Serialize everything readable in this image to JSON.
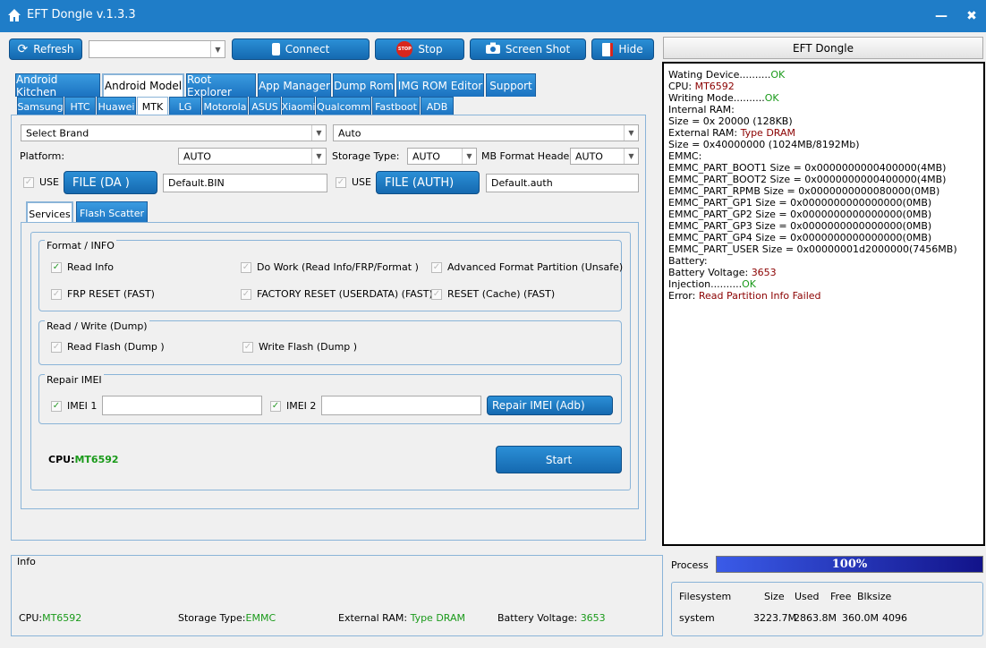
{
  "window": {
    "title": "EFT Dongle  v.1.3.3",
    "minimize": "—",
    "close": "✖"
  },
  "toolbar": {
    "refresh": "Refresh",
    "connect": "Connect",
    "stop": "Stop",
    "screenshot": "Screen Shot",
    "hide": "Hide",
    "port_value": "",
    "stop_icon_text": "STOP"
  },
  "right_header": "EFT Dongle",
  "main_tabs": [
    "Android Kitchen",
    "Android Model",
    "Root Explorer",
    "App Manager",
    "Dump Rom",
    "IMG ROM Editor",
    "Support"
  ],
  "sub_tabs": [
    "Samsung",
    "HTC",
    "Huawei",
    "MTK",
    "LG",
    "Motorola",
    "ASUS",
    "Xiaomi",
    "Qualcomm",
    "Fastboot",
    "ADB"
  ],
  "config": {
    "brand": "Select Brand",
    "auto_combo": "Auto",
    "platform_label": "Platform:",
    "platform": "AUTO",
    "storage_label": "Storage Type:",
    "storage": "AUTO",
    "mbformat_label": "MB Format Header",
    "mbformat": "AUTO",
    "use_label": "USE",
    "file_da": "FILE (DA )",
    "da_file": "Default.BIN",
    "use2_label": "USE",
    "file_auth": "FILE (AUTH)",
    "auth_file": "Default.auth"
  },
  "inner_tabs": [
    "Services",
    "Flash Scatter"
  ],
  "format_group": {
    "title": "Format / INFO",
    "items": [
      "Read Info",
      "Do Work (Read Info/FRP/Format )",
      "Advanced Format Partition (Unsafe)",
      "FRP RESET (FAST)",
      "FACTORY RESET (USERDATA) (FAST)",
      "RESET (Cache) (FAST)"
    ]
  },
  "rw_group": {
    "title": "Read / Write (Dump)",
    "items": [
      "Read Flash (Dump )",
      "Write Flash (Dump )"
    ]
  },
  "imei_group": {
    "title": "Repair IMEI",
    "imei1": "IMEI 1",
    "imei2": "IMEI 2",
    "imei1_value": "",
    "imei2_value": "",
    "repair_button": "Repair IMEI (Adb)"
  },
  "cpu_label": "CPU:",
  "cpu_value": "MT6592",
  "start_button": "Start",
  "log": [
    {
      "k": "Wating Device..........",
      "v": "OK",
      "c": "g"
    },
    {
      "k": "CPU: ",
      "v": "MT6592",
      "c": "r"
    },
    {
      "k": "Writing Mode..........",
      "v": "OK",
      "c": "g"
    },
    {
      "k": "Internal RAM:",
      "v": "",
      "c": ""
    },
    {
      "k": "Size = 0x 20000 (128KB)",
      "v": "",
      "c": ""
    },
    {
      "k": "External RAM: ",
      "v": "Type DRAM",
      "c": "r"
    },
    {
      "k": "Size = 0x40000000 (1024MB/8192Mb)",
      "v": "",
      "c": ""
    },
    {
      "k": "EMMC:",
      "v": "",
      "c": ""
    },
    {
      "k": "EMMC_PART_BOOT1 Size = 0x0000000000400000(4MB)",
      "v": "",
      "c": ""
    },
    {
      "k": "EMMC_PART_BOOT2 Size = 0x0000000000400000(4MB)",
      "v": "",
      "c": ""
    },
    {
      "k": "EMMC_PART_RPMB Size = 0x0000000000080000(0MB)",
      "v": "",
      "c": ""
    },
    {
      "k": "EMMC_PART_GP1 Size = 0x0000000000000000(0MB)",
      "v": "",
      "c": ""
    },
    {
      "k": "EMMC_PART_GP2 Size = 0x0000000000000000(0MB)",
      "v": "",
      "c": ""
    },
    {
      "k": "EMMC_PART_GP3 Size = 0x0000000000000000(0MB)",
      "v": "",
      "c": ""
    },
    {
      "k": "EMMC_PART_GP4 Size = 0x0000000000000000(0MB)",
      "v": "",
      "c": ""
    },
    {
      "k": "EMMC_PART_USER Size = 0x00000001d2000000(7456MB)",
      "v": "",
      "c": ""
    },
    {
      "k": "Battery:",
      "v": "",
      "c": ""
    },
    {
      "k": "Battery Voltage: ",
      "v": "3653",
      "c": "r"
    },
    {
      "k": "Injection..........",
      "v": "OK",
      "c": "g"
    },
    {
      "k": "Error: ",
      "v": "Read Partition Info Failed",
      "c": "r"
    }
  ],
  "info": {
    "title": "Info",
    "cpu_label": "CPU:",
    "cpu": "MT6592",
    "storage_label": "Storage Type:",
    "storage": "EMMC",
    "extram_label": "External RAM: ",
    "extram": "Type DRAM",
    "battery_label": "Battery Voltage: ",
    "battery": "3653"
  },
  "process": {
    "label": "Process",
    "percent_text": "100%",
    "percent": 100
  },
  "fs": {
    "headers": [
      "Filesystem",
      "Size",
      "Used",
      "Free",
      "Blksize"
    ],
    "row": [
      "system",
      "3223.7M",
      "2863.8M",
      "360.0M",
      "4096"
    ]
  },
  "colors": {
    "accent": "#1f7dc8",
    "ok": "#1a9a1a",
    "error": "#8b0000"
  }
}
